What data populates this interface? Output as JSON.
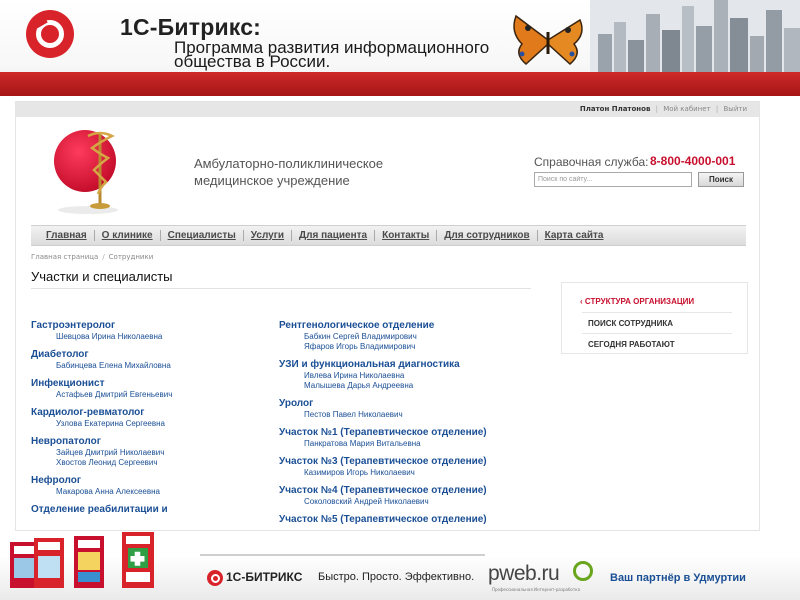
{
  "banner": {
    "brand": "1С-Битрикс:",
    "subtitle_line1": "Программа развития информационного",
    "subtitle_line2": "общества в России."
  },
  "userbar": {
    "user": "Платон Платонов",
    "cabinet": "Мой кабинет",
    "logout": "Выйти"
  },
  "clinic": {
    "name_line1": "Амбулаторно-поликлиническое",
    "name_line2": "медицинское учреждение"
  },
  "help": {
    "label": "Справочная служба:",
    "phone": "8-800-4000-001"
  },
  "search": {
    "placeholder": "Поиск по сайту...",
    "button": "Поиск"
  },
  "nav": {
    "items": [
      "Главная",
      "О клинике",
      "Специалисты",
      "Услуги",
      "Для пациента",
      "Контакты",
      "Для сотрудников",
      "Карта сайта"
    ]
  },
  "breadcrumb": {
    "home": "Главная страница",
    "current": "Сотрудники"
  },
  "page": {
    "title": "Участки и специалисты"
  },
  "left_column": [
    {
      "dept": "Гастроэнтеролог",
      "staff": [
        "Шевцова Ирина Николаевна"
      ]
    },
    {
      "dept": "Диабетолог",
      "staff": [
        "Бабинцева Елена Михайловна"
      ]
    },
    {
      "dept": "Инфекционист",
      "staff": [
        "Астафьев Дмитрий Евгеньевич"
      ]
    },
    {
      "dept": "Кардиолог-ревматолог",
      "staff": [
        "Узлова Екатерина Сергеевна"
      ]
    },
    {
      "dept": "Невропатолог",
      "staff": [
        "Зайцев Дмитрий Николаевич",
        "Хвостов Леонид Сергеевич"
      ]
    },
    {
      "dept": "Нефролог",
      "staff": [
        "Макарова Анна Алексеевна"
      ]
    },
    {
      "dept": "Отделение реабилитации и",
      "staff": []
    }
  ],
  "right_column": [
    {
      "dept": "Рентгенологическое отделение",
      "staff": [
        "Бабкин Сергей Владимирович",
        "Яфаров Игорь Владимирович"
      ]
    },
    {
      "dept": "УЗИ и функциональная диагностика",
      "staff": [
        "Ивлева Ирина Николаевна",
        "Малышева Дарья Андреевна"
      ]
    },
    {
      "dept": "Уролог",
      "staff": [
        "Пестов Павел Николаевич"
      ]
    },
    {
      "dept": "Участок №1 (Терапевтическое отделение)",
      "staff": [
        "Панкратова Мария Витальевна"
      ]
    },
    {
      "dept": "Участок №3 (Терапевтическое отделение)",
      "staff": [
        "Казимиров Игорь Николаевич"
      ]
    },
    {
      "dept": "Участок №4 (Терапевтическое отделение)",
      "staff": [
        "Соколовский Андрей Николаевич"
      ]
    },
    {
      "dept": "Участок №5 (Терапевтическое отделение)",
      "staff": []
    }
  ],
  "sidebar": {
    "active_marker": "‹",
    "items": [
      "СТРУКТУРА ОРГАНИЗАЦИИ",
      "ПОИСК СОТРУДНИКА",
      "СЕГОДНЯ РАБОТАЮТ"
    ]
  },
  "footer": {
    "brand": "1С-БИТРИКС",
    "slogan": "Быстро. Просто. Эффективно.",
    "pweb": "pweb.ru",
    "pweb_sub": "Профессиональная Интернет-разработка",
    "partner": "Ваш партнёр в Удмуртии"
  },
  "colors": {
    "accent_red": "#c8102e",
    "link_blue": "#1b4f95"
  }
}
